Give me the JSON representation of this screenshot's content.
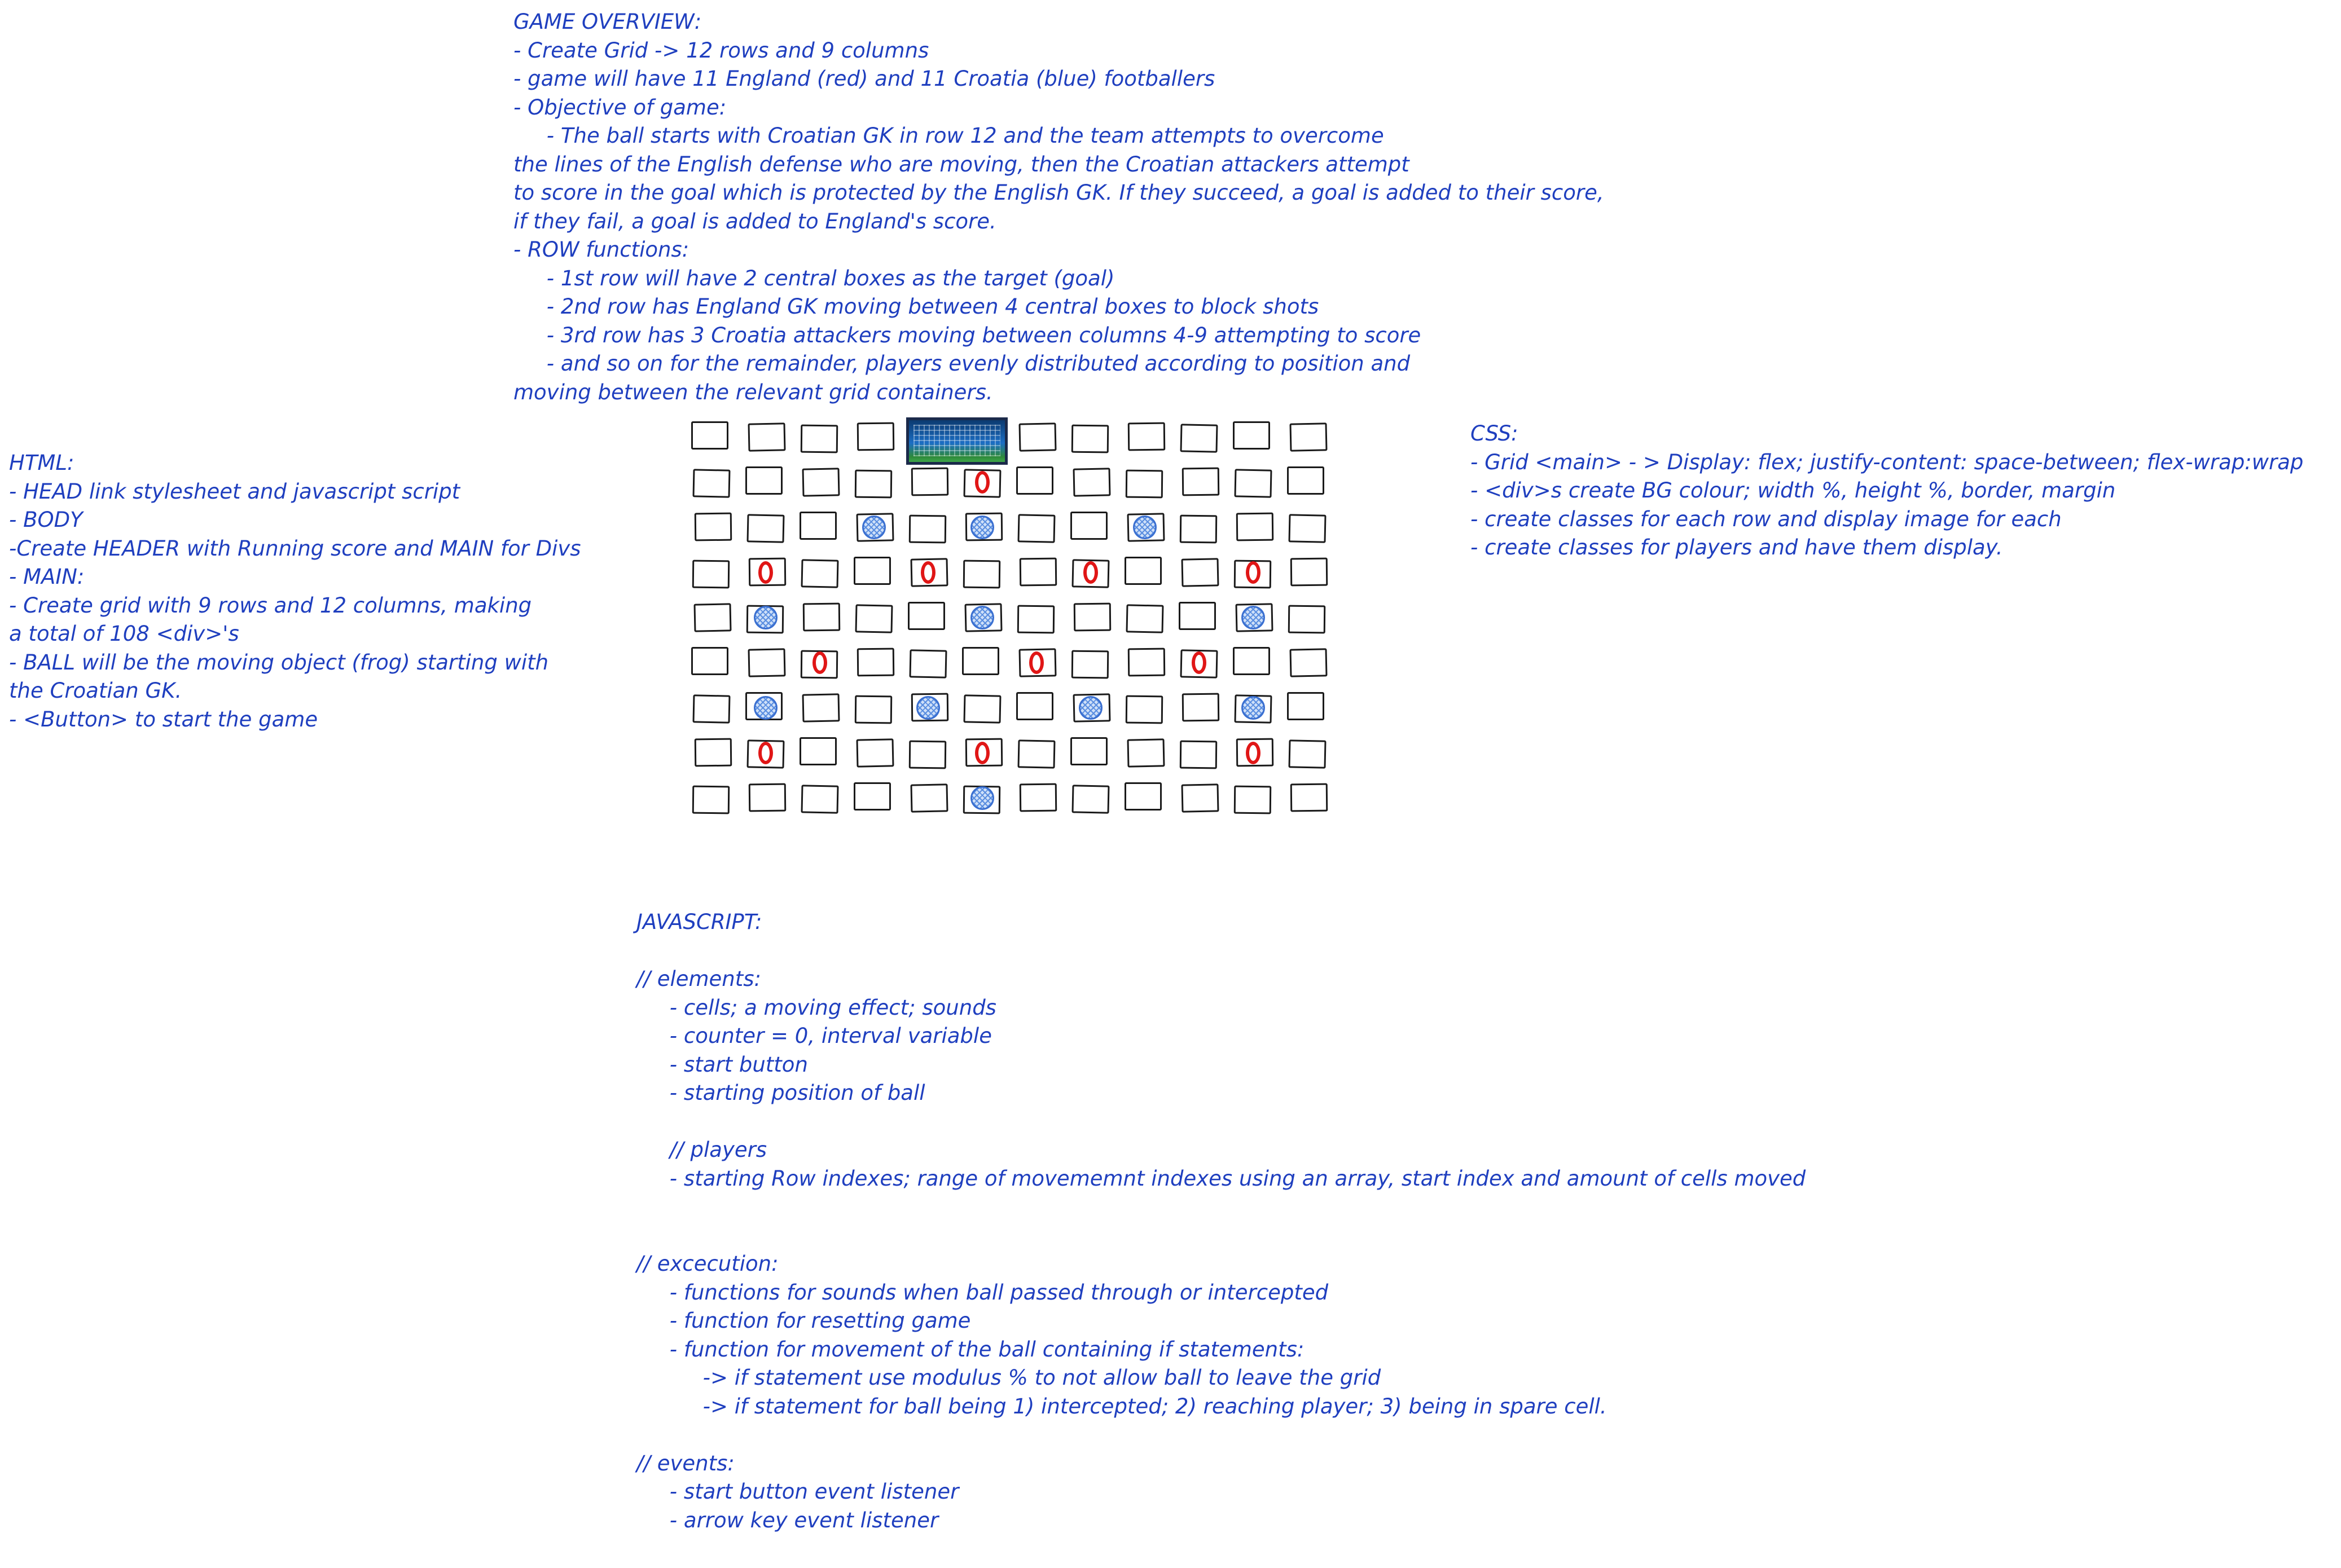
{
  "overview": [
    "GAME OVERVIEW:",
    "- Create Grid -> 12 rows and 9 columns",
    "- game will have 11 England (red) and 11 Croatia (blue) footballers",
    "- Objective of game:",
    "     - The ball starts with Croatian GK in row 12 and the team attempts to overcome",
    "the lines of the English defense who are moving, then the Croatian attackers attempt",
    "to score in the goal which is protected by the English GK. If they succeed, a goal is added to their score,",
    "if they fail, a goal is added to England's score.",
    "- ROW functions:",
    "     - 1st row will have 2 central boxes as the target (goal)",
    "     - 2nd row has England GK moving between 4 central boxes to block shots",
    "     - 3rd row has 3 Croatia attackers moving between columns 4-9 attempting to score",
    "     - and so on for the remainder, players evenly distributed according to position and",
    "moving between the relevant grid containers."
  ],
  "html_notes": [
    "HTML:",
    "- HEAD link stylesheet and javascript script",
    "- BODY",
    "-Create HEADER with Running score and MAIN for Divs",
    "- MAIN:",
    "- Create grid with 9 rows and 12 columns, making",
    "a total of 108 <div>'s",
    "- BALL will be the moving object (frog) starting with",
    "the Croatian GK.",
    "- <Button> to start the game"
  ],
  "css_notes": [
    "CSS:",
    "- Grid <main> - > Display: flex; justify-content: space-between; flex-wrap:wrap",
    "- <div>s create BG colour; width %, height %, border, margin",
    "- create classes for each row and display image for each",
    "- create classes for players and have them display."
  ],
  "js_notes": [
    "JAVASCRIPT:",
    "",
    "// elements:",
    "     - cells; a moving effect; sounds",
    "     - counter = 0, interval variable",
    "     - start button",
    "     - starting position of ball",
    "",
    "     // players",
    "     - starting Row indexes; range of movememnt indexes using an array, start index and amount of cells moved",
    "",
    "",
    "// excecution:",
    "     - functions for sounds when ball passed through or intercepted",
    "     - function for resetting game",
    "     - function for movement of the ball containing if statements:",
    "          -> if statement use modulus % to not allow ball to leave the grid",
    "          -> if statement for ball being 1) intercepted; 2) reaching player; 3) being in spare cell.",
    "",
    "// events:",
    "     - start button event listener",
    "     - arrow key event listener"
  ],
  "grid": {
    "rows": 9,
    "columns": 12,
    "goal": {
      "row": 0,
      "col_start": 4,
      "col_span": 2
    },
    "colors": {
      "england": "#e01616",
      "croatia": "#3a6fd0",
      "text": "#1f3fbf"
    },
    "england_players": [
      {
        "row": 1,
        "col": 5
      },
      {
        "row": 3,
        "col": 1
      },
      {
        "row": 3,
        "col": 4
      },
      {
        "row": 3,
        "col": 7
      },
      {
        "row": 3,
        "col": 10
      },
      {
        "row": 5,
        "col": 2
      },
      {
        "row": 5,
        "col": 6
      },
      {
        "row": 5,
        "col": 9
      },
      {
        "row": 7,
        "col": 1
      },
      {
        "row": 7,
        "col": 5
      },
      {
        "row": 7,
        "col": 10
      }
    ],
    "croatia_players": [
      {
        "row": 2,
        "col": 3
      },
      {
        "row": 2,
        "col": 5
      },
      {
        "row": 2,
        "col": 8
      },
      {
        "row": 4,
        "col": 1
      },
      {
        "row": 4,
        "col": 5
      },
      {
        "row": 4,
        "col": 10
      },
      {
        "row": 6,
        "col": 1
      },
      {
        "row": 6,
        "col": 4
      },
      {
        "row": 6,
        "col": 7
      },
      {
        "row": 6,
        "col": 10
      },
      {
        "row": 8,
        "col": 5
      }
    ]
  }
}
